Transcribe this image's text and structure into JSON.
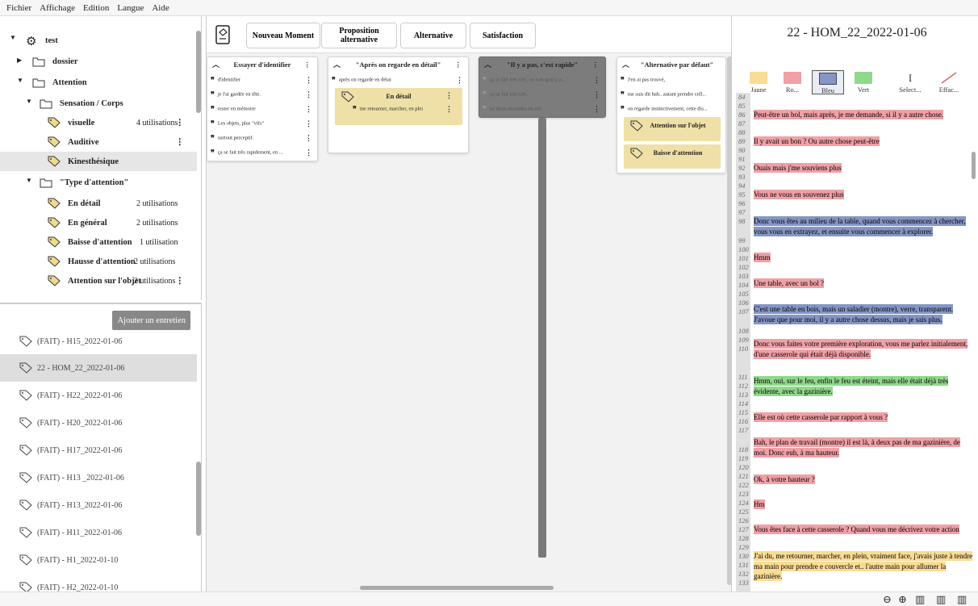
{
  "menu": [
    "Fichier",
    "Affichage",
    "Edition",
    "Langue",
    "Aide"
  ],
  "tree": {
    "root": "test",
    "items": [
      {
        "label": "dossier",
        "count": ""
      },
      {
        "label": "Attention",
        "count": ""
      },
      {
        "label": "Sensation / Corps",
        "count": ""
      },
      {
        "label": "visuelle",
        "count": "4 utilisations"
      },
      {
        "label": "Auditive",
        "count": ""
      },
      {
        "label": "Kinesthésique",
        "count": ""
      },
      {
        "label": "\"Type d'attention\"",
        "count": ""
      },
      {
        "label": "En détail",
        "count": "2 utilisations"
      },
      {
        "label": "En général",
        "count": "2 utilisations"
      },
      {
        "label": "Baisse d'attention",
        "count": "1 utilisation"
      },
      {
        "label": "Hausse d'attention",
        "count": "2 utilisations"
      },
      {
        "label": "Attention sur l'objet",
        "count": "2 utilisations"
      }
    ]
  },
  "interviews": {
    "add_label": "Ajouter un entretien",
    "items": [
      "(FAIT) - H15_2022-01-06",
      "22 - HOM_22_2022-01-06",
      "(FAIT) - H22_2022-01-06",
      "(FAIT) - H20_2022-01-06",
      "(FAIT) - H17_2022-01-06",
      "(FAIT) - H13 _2022-01-06",
      "(FAIT) - H13_2022-01-06",
      "(FAIT) - H11_2022-01-06",
      "(FAIT) - H1_2022-01-10",
      "(FAIT) - H2_2022-01-10"
    ]
  },
  "toolbar": {
    "new_moment": "Nouveau Moment",
    "prop_alt": "Proposition alternative",
    "alternative": "Alternative",
    "satisfaction": "Satisfaction"
  },
  "columns": [
    {
      "title": "Essayer d'identifier",
      "items": [
        "d'identifier",
        "je l'ai gardée en tête.",
        "rester en mémoire",
        "Les objets, plus \"vifs\"",
        "surtout perceptif.",
        "ça se fait très rapidement, en ..."
      ]
    },
    {
      "title": "\"Après on regarde en détail\"",
      "items": [
        "après on regarde en détai"
      ],
      "tag": "En détail",
      "tag_item": "me retourner, marcher, en plei"
    },
    {
      "title": "\"Il y a pas, c'est rapide\"",
      "items": [
        "ça se fait très vite, en voit qu'il y a...",
        "ça se fait très vite,",
        "en deux secondes on sait"
      ]
    },
    {
      "title": "\"Alternative par défaut\"",
      "items": [
        "J'en ai pas trouvé,",
        "me suis dit bah.. autant prendre cell...",
        "on regarde instinctivement, cette dis..."
      ],
      "tags": [
        "Attention sur l'objet",
        "Baisse d'attention"
      ]
    }
  ],
  "transcript": {
    "title": "22 - HOM_22_2022-01-06",
    "highlighters": [
      {
        "label": "Jaune",
        "color": "#f9dc95"
      },
      {
        "label": "Ro...",
        "color": "#f0a0a6"
      },
      {
        "label": "Bleu",
        "color": "#8596c5"
      },
      {
        "label": "Vert",
        "color": "#90d88a"
      },
      {
        "label": "Select...",
        "color": ""
      },
      {
        "label": "Effac...",
        "color": ""
      }
    ],
    "line_numbers": [
      "84",
      "85",
      "86",
      "87",
      "88",
      "89",
      "90",
      "91",
      "92",
      "93",
      "94",
      "95",
      "96",
      "97",
      "98",
      "99",
      "100",
      "101",
      "102",
      "103",
      "104",
      "105",
      "106",
      "107",
      "108",
      "109",
      "110",
      "111",
      "112",
      "113",
      "114",
      "115",
      "116",
      "117",
      "118",
      "119",
      "120",
      "121",
      "122",
      "123",
      "124",
      "125",
      "126",
      "127",
      "128",
      "129",
      "130",
      "131",
      "132",
      "133"
    ],
    "lines": [
      {
        "text": "Peut-être un bol, mais après, je me demande, si il y a autre chose."
      },
      {
        "text": "Il y avait un bon ? Ou autre chose peut-être"
      },
      {
        "text": "Ouais mais j'me souviens plus"
      },
      {
        "text": "Vous ne vous en souvenez plus"
      },
      {
        "text": "Donc vous êtes au milieu de la table, quand vous commencez à chercher, vous vous en extrayez, et ensuite vous commencer à explorer."
      },
      {
        "text": "Hmm"
      },
      {
        "text": "Une table, avec un bol ?"
      },
      {
        "text": "C'est une table en bois, mais un saladier (montre), verre, transparent. J'avoue que pour moi, il y a autre chose dessus, mais je sais plus."
      },
      {
        "text": "Donc vous faites votre première exploration, vous me parlez initialement, d'une casserole qui était déjà disponible."
      },
      {
        "text": "Hmm, oui, sur le feu, enfin le feu est éteint, mais elle était déjà très évidente, avec la gazinière."
      },
      {
        "text": "Elle est où cette casserole par rapport à vous ?"
      },
      {
        "text": "Bah, le plan de travail (montre) il est là, à deux pas de ma gazinière, de moi. Donc euh, à ma hauteur."
      },
      {
        "text": "Ok, à votre hauteur ?"
      },
      {
        "text": "Hm"
      },
      {
        "text": "Vous êtes face à cette casserole ? Quand vous me décrivez votre action"
      },
      {
        "text": "J'ai du, me retourner, marcher, en plein, vraiment face, j'avais juste à tendre ma main pour prendre e couvercle et.. l'autre main pour allumer la gazinière."
      }
    ]
  }
}
